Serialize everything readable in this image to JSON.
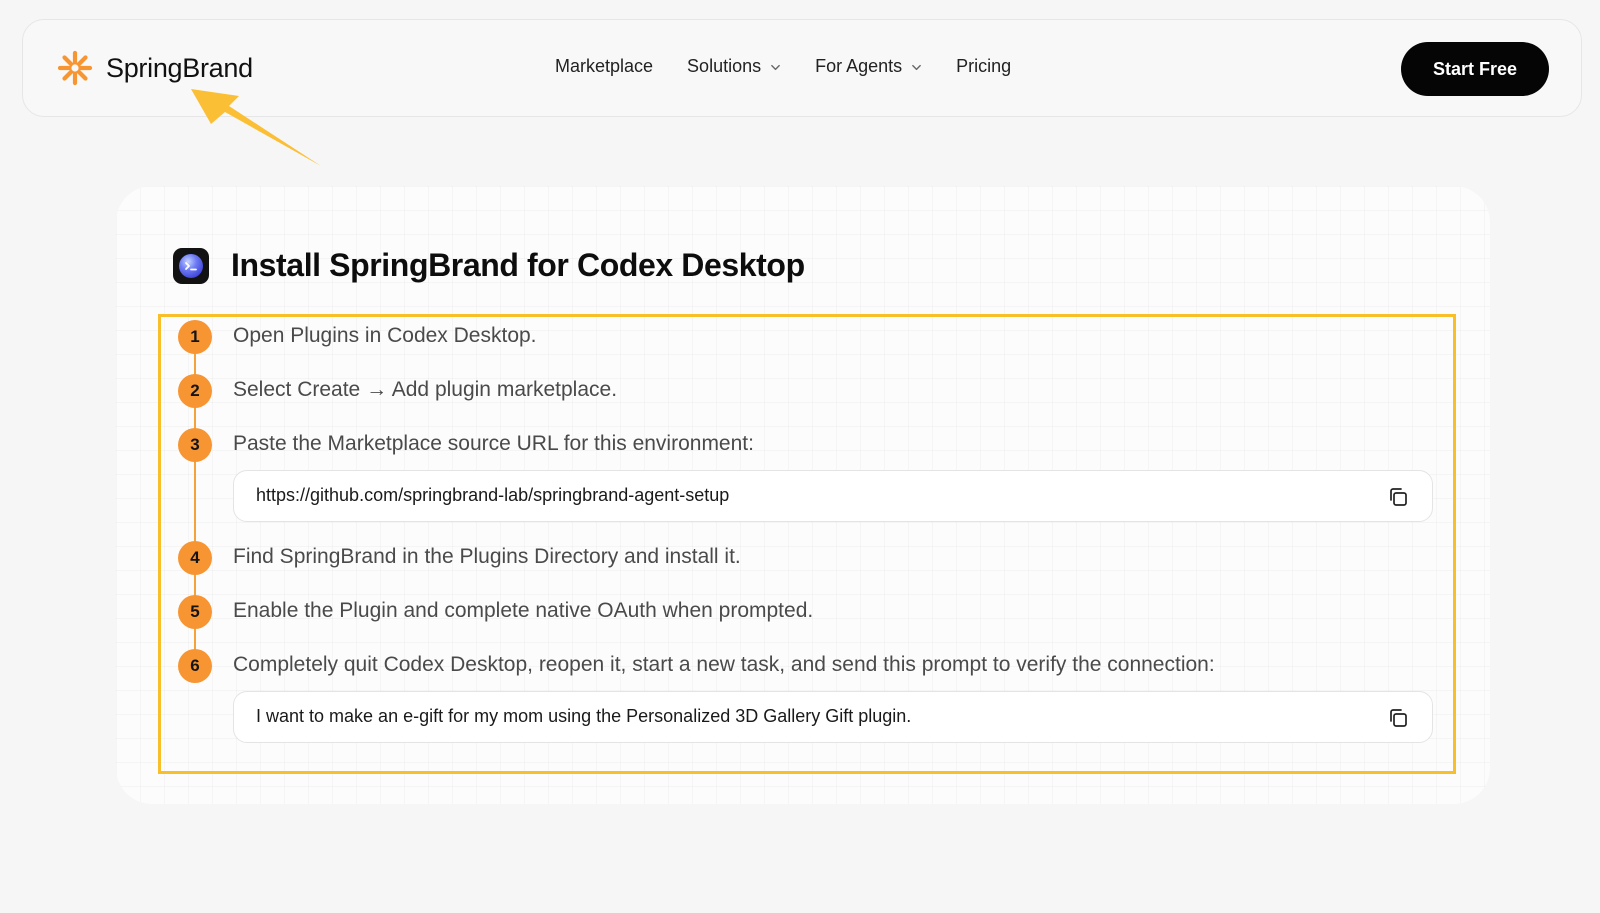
{
  "header": {
    "brand": "SpringBrand",
    "nav": [
      {
        "label": "Marketplace",
        "has_dropdown": false
      },
      {
        "label": "Solutions",
        "has_dropdown": true
      },
      {
        "label": "For Agents",
        "has_dropdown": true
      },
      {
        "label": "Pricing",
        "has_dropdown": false
      }
    ],
    "cta_label": "Start Free"
  },
  "card": {
    "title": "Install SpringBrand for Codex Desktop",
    "steps": [
      {
        "num": "1",
        "text": "Open Plugins in Codex Desktop."
      },
      {
        "num": "2",
        "text": "Select Create → Add plugin marketplace."
      },
      {
        "num": "3",
        "text": "Paste the Marketplace source URL for this environment:"
      },
      {
        "num": "4",
        "text": "Find SpringBrand in the Plugins Directory and install it."
      },
      {
        "num": "5",
        "text": "Enable the Plugin and complete native OAuth when prompted."
      },
      {
        "num": "6",
        "text": "Completely quit Codex Desktop, reopen it, start a new task, and send this prompt to verify the connection:"
      }
    ],
    "url_value": "https://github.com/springbrand-lab/springbrand-agent-setup",
    "prompt_value": "I want to make an e-gift for my mom using the Personalized 3D Gallery Gift plugin."
  },
  "icons": {
    "logo": "asterisk-logo-icon",
    "chevron": "chevron-down-icon",
    "app": "terminal-app-icon",
    "copy": "copy-icon",
    "annotation": "annotation-arrow-icon"
  },
  "colors": {
    "brand_orange": "#f79533",
    "highlight_border": "#f8bf2a",
    "cta_bg": "#050505",
    "arrow": "#fbbf36"
  }
}
